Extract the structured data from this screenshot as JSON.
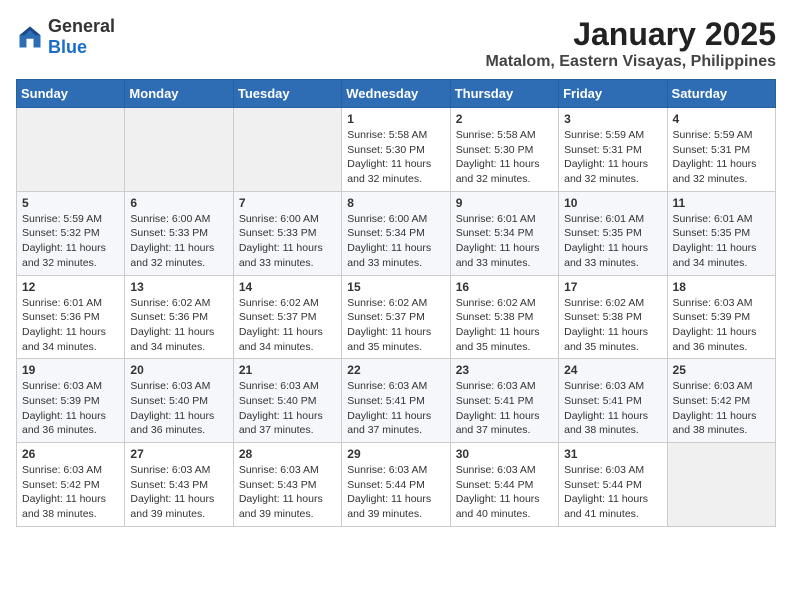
{
  "logo": {
    "text_general": "General",
    "text_blue": "Blue"
  },
  "header": {
    "month": "January 2025",
    "location": "Matalom, Eastern Visayas, Philippines"
  },
  "weekdays": [
    "Sunday",
    "Monday",
    "Tuesday",
    "Wednesday",
    "Thursday",
    "Friday",
    "Saturday"
  ],
  "weeks": [
    [
      {
        "day": "",
        "info": ""
      },
      {
        "day": "",
        "info": ""
      },
      {
        "day": "",
        "info": ""
      },
      {
        "day": "1",
        "info": "Sunrise: 5:58 AM\nSunset: 5:30 PM\nDaylight: 11 hours and 32 minutes."
      },
      {
        "day": "2",
        "info": "Sunrise: 5:58 AM\nSunset: 5:30 PM\nDaylight: 11 hours and 32 minutes."
      },
      {
        "day": "3",
        "info": "Sunrise: 5:59 AM\nSunset: 5:31 PM\nDaylight: 11 hours and 32 minutes."
      },
      {
        "day": "4",
        "info": "Sunrise: 5:59 AM\nSunset: 5:31 PM\nDaylight: 11 hours and 32 minutes."
      }
    ],
    [
      {
        "day": "5",
        "info": "Sunrise: 5:59 AM\nSunset: 5:32 PM\nDaylight: 11 hours and 32 minutes."
      },
      {
        "day": "6",
        "info": "Sunrise: 6:00 AM\nSunset: 5:33 PM\nDaylight: 11 hours and 32 minutes."
      },
      {
        "day": "7",
        "info": "Sunrise: 6:00 AM\nSunset: 5:33 PM\nDaylight: 11 hours and 33 minutes."
      },
      {
        "day": "8",
        "info": "Sunrise: 6:00 AM\nSunset: 5:34 PM\nDaylight: 11 hours and 33 minutes."
      },
      {
        "day": "9",
        "info": "Sunrise: 6:01 AM\nSunset: 5:34 PM\nDaylight: 11 hours and 33 minutes."
      },
      {
        "day": "10",
        "info": "Sunrise: 6:01 AM\nSunset: 5:35 PM\nDaylight: 11 hours and 33 minutes."
      },
      {
        "day": "11",
        "info": "Sunrise: 6:01 AM\nSunset: 5:35 PM\nDaylight: 11 hours and 34 minutes."
      }
    ],
    [
      {
        "day": "12",
        "info": "Sunrise: 6:01 AM\nSunset: 5:36 PM\nDaylight: 11 hours and 34 minutes."
      },
      {
        "day": "13",
        "info": "Sunrise: 6:02 AM\nSunset: 5:36 PM\nDaylight: 11 hours and 34 minutes."
      },
      {
        "day": "14",
        "info": "Sunrise: 6:02 AM\nSunset: 5:37 PM\nDaylight: 11 hours and 34 minutes."
      },
      {
        "day": "15",
        "info": "Sunrise: 6:02 AM\nSunset: 5:37 PM\nDaylight: 11 hours and 35 minutes."
      },
      {
        "day": "16",
        "info": "Sunrise: 6:02 AM\nSunset: 5:38 PM\nDaylight: 11 hours and 35 minutes."
      },
      {
        "day": "17",
        "info": "Sunrise: 6:02 AM\nSunset: 5:38 PM\nDaylight: 11 hours and 35 minutes."
      },
      {
        "day": "18",
        "info": "Sunrise: 6:03 AM\nSunset: 5:39 PM\nDaylight: 11 hours and 36 minutes."
      }
    ],
    [
      {
        "day": "19",
        "info": "Sunrise: 6:03 AM\nSunset: 5:39 PM\nDaylight: 11 hours and 36 minutes."
      },
      {
        "day": "20",
        "info": "Sunrise: 6:03 AM\nSunset: 5:40 PM\nDaylight: 11 hours and 36 minutes."
      },
      {
        "day": "21",
        "info": "Sunrise: 6:03 AM\nSunset: 5:40 PM\nDaylight: 11 hours and 37 minutes."
      },
      {
        "day": "22",
        "info": "Sunrise: 6:03 AM\nSunset: 5:41 PM\nDaylight: 11 hours and 37 minutes."
      },
      {
        "day": "23",
        "info": "Sunrise: 6:03 AM\nSunset: 5:41 PM\nDaylight: 11 hours and 37 minutes."
      },
      {
        "day": "24",
        "info": "Sunrise: 6:03 AM\nSunset: 5:41 PM\nDaylight: 11 hours and 38 minutes."
      },
      {
        "day": "25",
        "info": "Sunrise: 6:03 AM\nSunset: 5:42 PM\nDaylight: 11 hours and 38 minutes."
      }
    ],
    [
      {
        "day": "26",
        "info": "Sunrise: 6:03 AM\nSunset: 5:42 PM\nDaylight: 11 hours and 38 minutes."
      },
      {
        "day": "27",
        "info": "Sunrise: 6:03 AM\nSunset: 5:43 PM\nDaylight: 11 hours and 39 minutes."
      },
      {
        "day": "28",
        "info": "Sunrise: 6:03 AM\nSunset: 5:43 PM\nDaylight: 11 hours and 39 minutes."
      },
      {
        "day": "29",
        "info": "Sunrise: 6:03 AM\nSunset: 5:44 PM\nDaylight: 11 hours and 39 minutes."
      },
      {
        "day": "30",
        "info": "Sunrise: 6:03 AM\nSunset: 5:44 PM\nDaylight: 11 hours and 40 minutes."
      },
      {
        "day": "31",
        "info": "Sunrise: 6:03 AM\nSunset: 5:44 PM\nDaylight: 11 hours and 41 minutes."
      },
      {
        "day": "",
        "info": ""
      }
    ]
  ]
}
